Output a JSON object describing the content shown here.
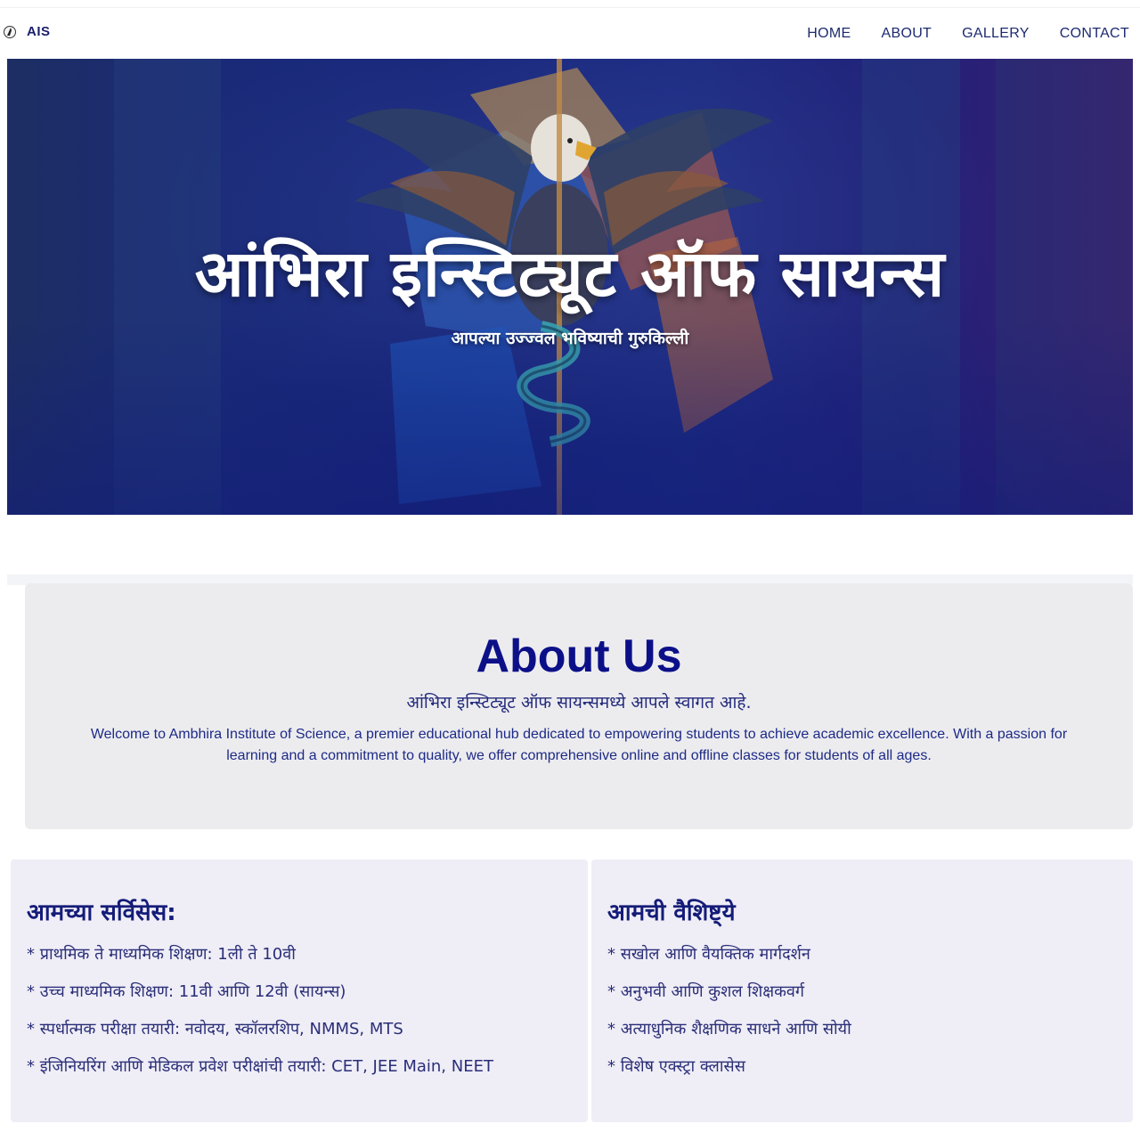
{
  "nav": {
    "logo_icon": "eagle-logo-icon",
    "logo_text": "AIS",
    "items": [
      "HOME",
      "ABOUT",
      "GALLERY",
      "CONTACT"
    ]
  },
  "hero": {
    "title": "आंभिरा इन्स्टिट्यूट ऑफ सायन्स",
    "subtitle": "आपल्या उज्ज्वल भविष्याची गुरुकिल्ली"
  },
  "about": {
    "title": "About Us",
    "subtitle": "आंभिरा इन्स्टिट्यूट ऑफ सायन्समध्ये आपले स्वागत आहे.",
    "text": "Welcome to Ambhira Institute of Science, a premier educational hub dedicated to empowering students to achieve academic excellence. With a passion for learning and a commitment to quality, we offer comprehensive online and offline classes for students of all ages."
  },
  "services": {
    "title": "आमच्या सर्विसेस:",
    "items": [
      "* प्राथमिक ते माध्यमिक शिक्षण: 1ली ते 10वी",
      "* उच्च माध्यमिक शिक्षण: 11वी आणि 12वी (सायन्स)",
      "* स्पर्धात्मक परीक्षा तयारी: नवोदय, स्कॉलरशिप, NMMS, MTS",
      "* इंजिनियरिंग आणि मेडिकल प्रवेश परीक्षांची तयारी: CET, JEE Main, NEET"
    ]
  },
  "features": {
    "title": "आमची वैशिष्ट्ये",
    "items": [
      "* सखोल आणि वैयक्तिक मार्गदर्शन",
      "* अनुभवी आणि कुशल शिक्षकवर्ग",
      "* अत्याधुनिक शैक्षणिक साधने आणि सोयी",
      "* विशेष एक्स्ट्रा क्लासेस"
    ]
  },
  "colors": {
    "brand_navy": "#0c1088",
    "hero_bg": "#17257a",
    "card_bg": "#efedf6",
    "about_bg": "#ececef"
  }
}
